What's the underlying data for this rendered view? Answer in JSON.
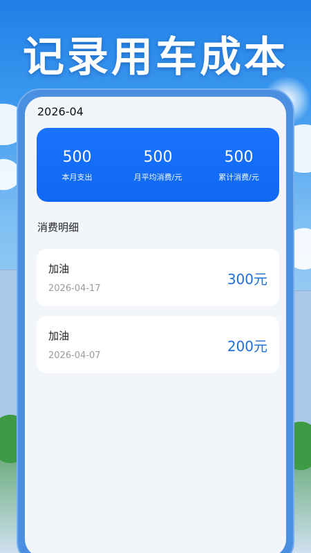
{
  "headline": "记录用车成本",
  "month": "2026-04",
  "summary": [
    {
      "value": "500",
      "label": "本月支出"
    },
    {
      "value": "500",
      "label": "月平均消费/元"
    },
    {
      "value": "500",
      "label": "累计消费/元"
    }
  ],
  "details_title": "消费明细",
  "records": [
    {
      "title": "加油",
      "date": "2026-04-17",
      "amount": "300元"
    },
    {
      "title": "加油",
      "date": "2026-04-07",
      "amount": "200元"
    }
  ],
  "colors": {
    "accent": "#1a73ff",
    "amount": "#1f6fd6",
    "phone_frame": "#4b8fe0",
    "screen_bg": "#f2f6fa"
  }
}
